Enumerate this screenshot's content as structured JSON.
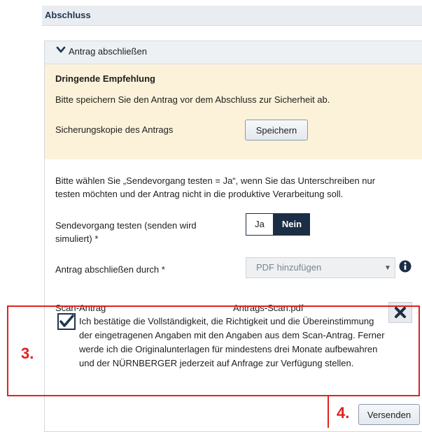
{
  "section": {
    "title": "Abschluss"
  },
  "accordion": {
    "label": "Antrag abschließen",
    "icon": "chevron-down-icon"
  },
  "recommendation": {
    "heading": "Dringende Empfehlung",
    "text": "Bitte speichern Sie den Antrag vor dem Abschluss zur Sicherheit ab.",
    "backup_label": "Sicherungskopie des Antrags",
    "save_button": "Speichern"
  },
  "info": {
    "line1": "Bitte wählen Sie „Sendevorgang testen = Ja“, wenn Sie das Unterschreiben nur",
    "line2": "testen möchten und der Antrag nicht in die produktive Verarbeitung soll."
  },
  "send_test": {
    "label_line1": "Sendevorgang testen (senden wird",
    "label_line2": "simuliert) *",
    "option_yes": "Ja",
    "option_no": "Nein",
    "selected": "Nein"
  },
  "complete_by": {
    "label": "Antrag abschließen durch *",
    "selected_value": "PDF hinzufügen",
    "icon": "info-icon"
  },
  "scan": {
    "label": "Scan-Antrag",
    "filename": "Antrags-Scan.pdf",
    "delete_icon": "close-icon"
  },
  "confirmation": {
    "checked": true,
    "line1": "Ich bestätige die Vollständigkeit, die Richtigkeit und die Übereinstimmung",
    "line2": "der eingetragenen Angaben mit den Angaben aus dem Scan-Antrag. Ferner",
    "line3": "werde ich die Originalunterlagen für mindestens drei Monate aufbewahren",
    "line4": "und der NÜRNBERGER jederzeit auf Anfrage zur Verfügung stellen."
  },
  "annotations": {
    "step3": "3.",
    "step4": "4.",
    "color": "#e0221f"
  },
  "actions": {
    "send_button": "Versenden"
  },
  "colors": {
    "navy": "#1c2e45",
    "recommend_bg": "#fcf2d9",
    "header_bg": "#e9edf1"
  }
}
